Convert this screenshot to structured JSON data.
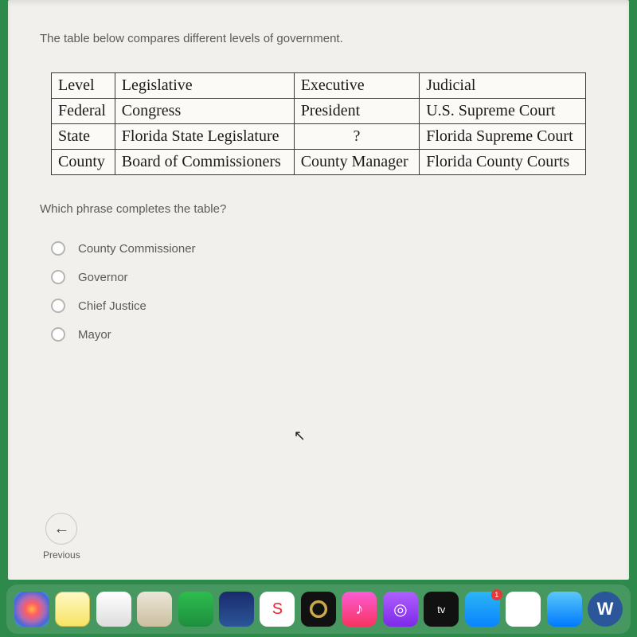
{
  "prompt": "The table below compares different levels of government.",
  "table": {
    "headers": [
      "Level",
      "Legislative",
      "Executive",
      "Judicial"
    ],
    "rows": [
      {
        "level": "Federal",
        "legislative": "Congress",
        "executive": "President",
        "judicial": "U.S. Supreme Court"
      },
      {
        "level": "State",
        "legislative": "Florida State Legislature",
        "executive": "?",
        "judicial": "Florida Supreme Court"
      },
      {
        "level": "County",
        "legislative": "Board of Commissioners",
        "executive": "County Manager",
        "judicial": "Florida County Courts"
      }
    ]
  },
  "sub_prompt": "Which phrase completes the table?",
  "options": [
    "County Commissioner",
    "Governor",
    "Chief Justice",
    "Mayor"
  ],
  "nav": {
    "previous": "Previous"
  },
  "dock": {
    "tv": "tv",
    "news_glyph": "S",
    "music_glyph": "♪",
    "pod_glyph": "◎",
    "store_badge": "1",
    "word_glyph": "W"
  }
}
